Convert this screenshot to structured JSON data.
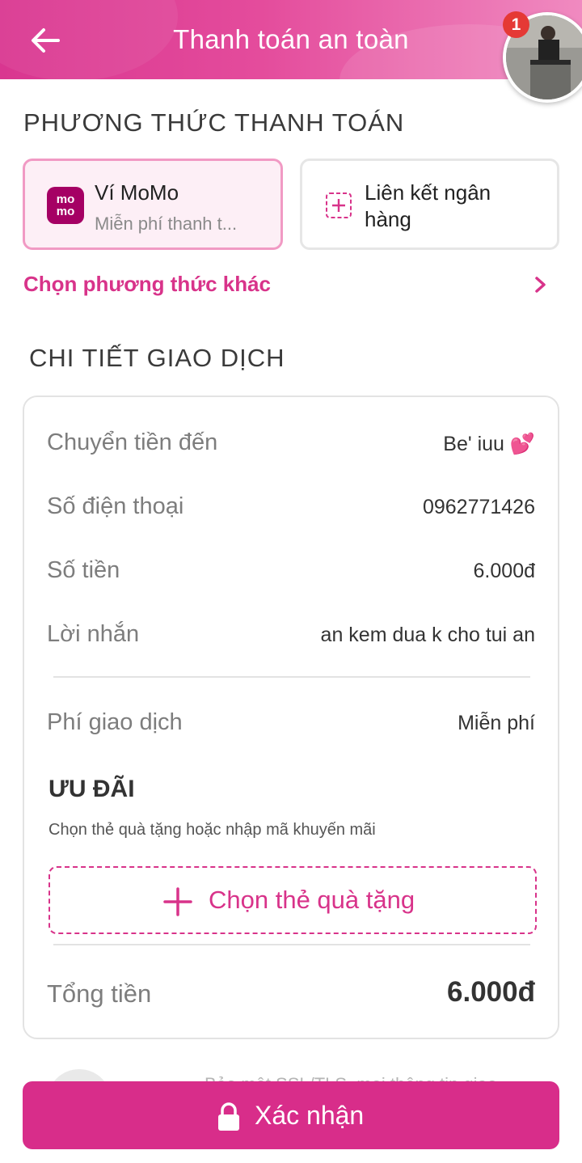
{
  "header": {
    "title": "Thanh toán an toàn",
    "notification_count": "1",
    "back_icon": "arrow-left-icon"
  },
  "payment_methods": {
    "section_title": "PHƯƠNG THỨC THANH TOÁN",
    "momo": {
      "logo_text": "mo mo",
      "title": "Ví MoMo",
      "subtitle": "Miễn phí thanh t..."
    },
    "bank": {
      "title_line1": "Liên kết ngân",
      "title_line2": "hàng",
      "icon": "plus-square-icon"
    },
    "other_link": "Chọn phương thức khác"
  },
  "transaction": {
    "section_title": "CHI TIẾT GIAO DỊCH",
    "rows": [
      {
        "label": "Chuyển tiền đến",
        "value": "Be' iuu 💕"
      },
      {
        "label": "Số điện thoại",
        "value": "0962771426"
      },
      {
        "label": "Số tiền",
        "value": "6.000đ"
      },
      {
        "label": "Lời nhắn",
        "value": "an kem dua k cho tui an"
      }
    ],
    "fee": {
      "label": "Phí giao dịch",
      "value": "Miễn phí"
    },
    "promo": {
      "title": "ƯU ĐÃI",
      "subtitle": "Chọn thẻ quà tặng hoặc nhập mã khuyến mãi",
      "gift_button": "Chọn thẻ quà tặng"
    },
    "total": {
      "label": "Tổng tiền",
      "value": "6.000đ"
    }
  },
  "security": {
    "text": "Bảo mật SSL/TLS, mọi thông tin giao"
  },
  "footer": {
    "confirm_label": "Xác nhận"
  },
  "colors": {
    "brand": "#d82d8a",
    "momo": "#a50064",
    "badge": "#e53935"
  }
}
